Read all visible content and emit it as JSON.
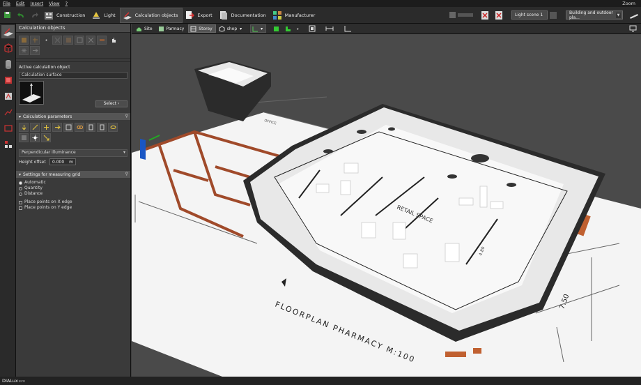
{
  "menu": {
    "items": [
      "File",
      "Edit",
      "Insert",
      "View",
      "?"
    ],
    "zoom": "Zoom"
  },
  "toolbar": {
    "tabs": [
      {
        "label": "Construction"
      },
      {
        "label": "Light"
      },
      {
        "label": "Calculation objects"
      },
      {
        "label": "Export"
      },
      {
        "label": "Documentation"
      },
      {
        "label": "Manufacturer"
      }
    ],
    "light_scene": "Light scene 1",
    "scope": "Building and outdoor pla..."
  },
  "panel": {
    "title": "Calculation objects",
    "active_object_header": "Active calculation object",
    "active_object_name": "Calculation surface",
    "select_label": "Select",
    "params_header": "Calculation parameters",
    "illuminance_type": "Perpendicular illuminance",
    "height_offset_label": "Height offset",
    "height_offset_value": "0.000",
    "height_offset_unit": "m",
    "grid_header": "Settings for measuring grid",
    "grid_options": [
      "Automatic",
      "Quantity",
      "Distance"
    ],
    "place_points": [
      "Place points on X edge",
      "Place points on Y edge"
    ]
  },
  "viewtabs": {
    "site": "Site",
    "parmacy": "Parmacy",
    "storey": "Storey",
    "shop": "shop"
  },
  "scene": {
    "texts": [
      "FLOORPLAN PHARMACY M:100",
      "RETAIL SPACE",
      "7.50",
      "4.80",
      "OFFICE"
    ],
    "colors": {
      "wall": "#2b2b2b",
      "floor": "#ffffff",
      "plan_wall": "#a04a2a",
      "ground": "#f4f4f4"
    }
  },
  "status": {
    "brand": "DIALux",
    "edition": "evo"
  }
}
